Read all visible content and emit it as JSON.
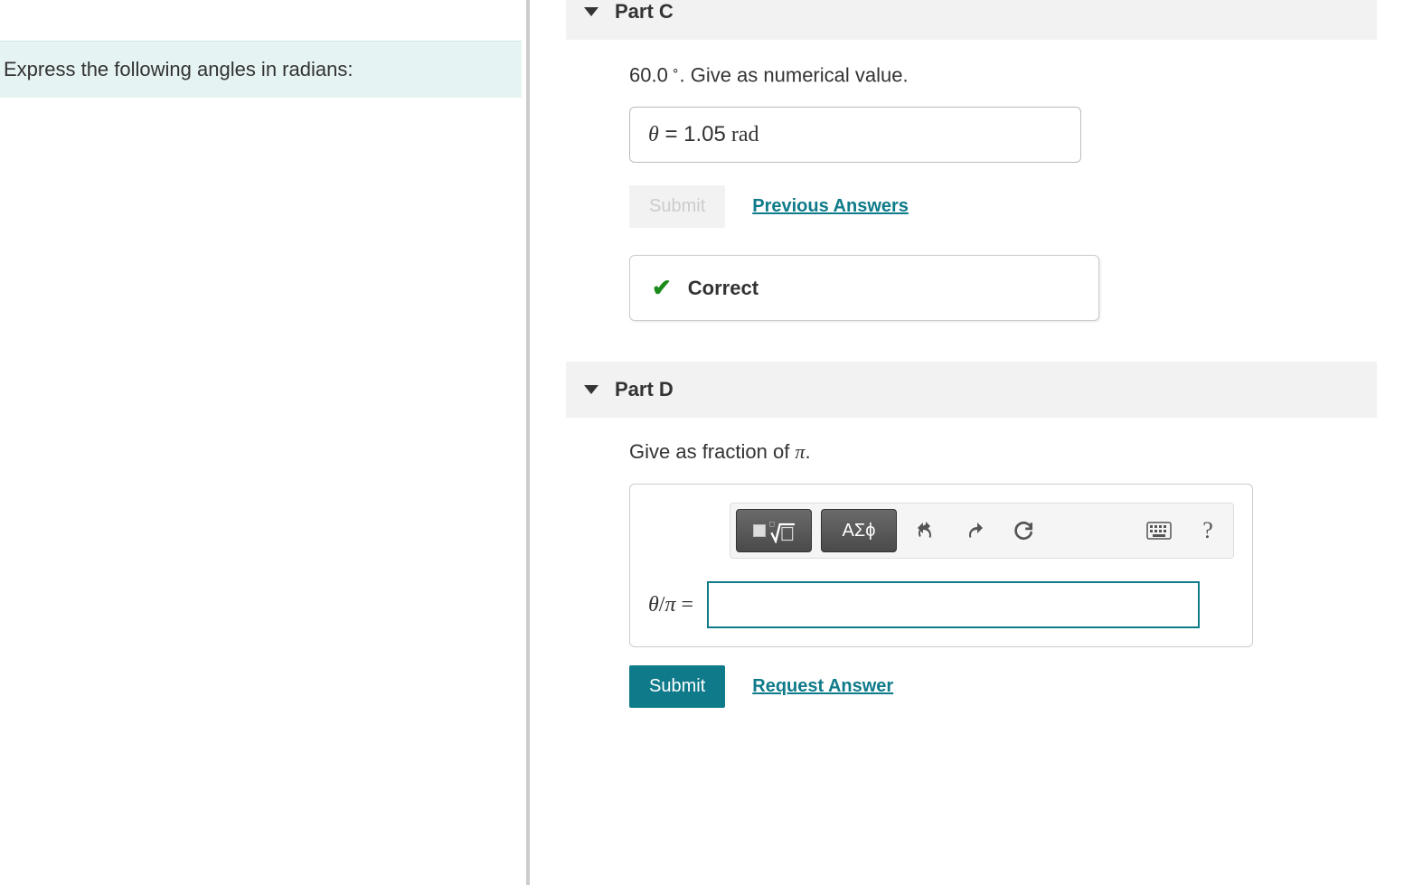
{
  "prompt": "Express the following angles in radians:",
  "part_c": {
    "title": "Part C",
    "instruction_prefix": "60.0",
    "instruction_suffix": ". Give as numerical value.",
    "answer_prefix": "θ",
    "answer_equals": " = ",
    "answer_value": "1.05",
    "answer_unit": "  rad",
    "submit_label": "Submit",
    "prev_answers_label": "Previous Answers",
    "feedback_label": "Correct"
  },
  "part_d": {
    "title": "Part D",
    "instruction": "Give as fraction of ",
    "pi": "π",
    "period": ".",
    "greek_btn": "ΑΣϕ",
    "lhs_theta": "θ",
    "lhs_slash": "/",
    "lhs_pi": "π",
    "lhs_equals": " =",
    "submit_label": "Submit",
    "request_answer_label": "Request Answer",
    "help_label": "?"
  }
}
